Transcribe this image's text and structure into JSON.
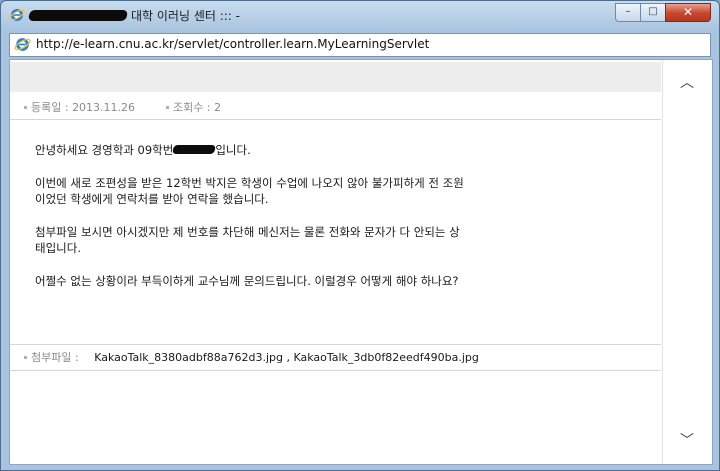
{
  "window": {
    "title": "대학 이러닝 센터 ::: -",
    "buttons": {
      "minimize": "–",
      "maximize": "□",
      "close": "✕"
    }
  },
  "address_bar": {
    "url": "http://e-learn.cnu.ac.kr/servlet/controller.learn.MyLearningServlet"
  },
  "post": {
    "date_label": "등록일 :",
    "date": "2013.11.26",
    "views_label": "조회수 :",
    "views": "2",
    "body": {
      "line1_before": "안녕하세요 경영학과 09학번",
      "line1_after": "입니다.",
      "line2": "이번에 새로 조편성을 받은 12학번 박지은 학생이 수업에 나오지 않아 불가피하게 전 조원",
      "line3": "이었던 학생에게 연락처를 받아 연락을 했습니다.",
      "line4": "첨부파일 보시면 아시겠지만 제 번호를 차단해 메신저는 물론 전화와 문자가 다 안되는 상",
      "line5": "태입니다.",
      "line6": "어쩔수 없는 상황이라 부득이하게 교수님께 문의드립니다. 이럴경우 어떻게 해야 하나요?"
    },
    "attachments_label": "첨부파일 :",
    "attachments": "KakaoTalk_8380adbf88a762d3.jpg , KakaoTalk_3db0f82eedf490ba.jpg"
  },
  "scrollbar": {
    "up": "︿",
    "down": "﹀"
  }
}
